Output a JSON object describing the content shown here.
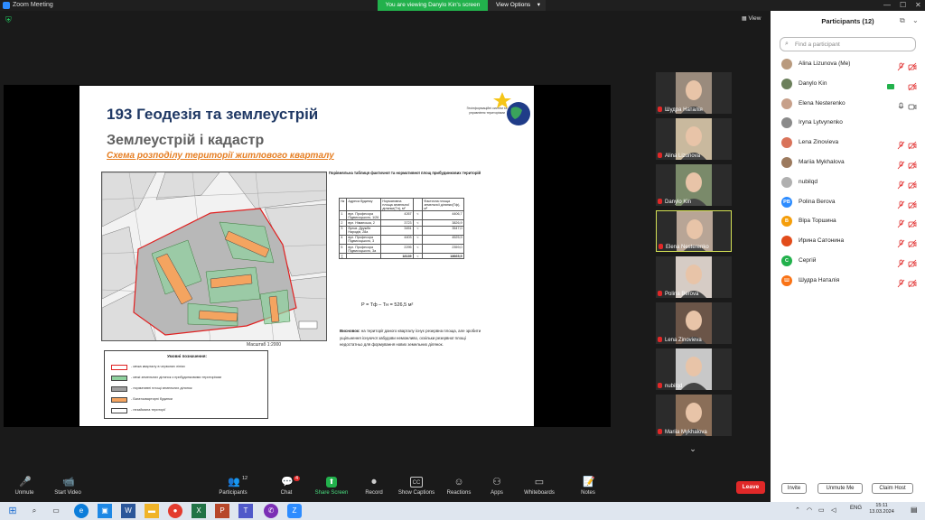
{
  "titlebar": {
    "title": "Zoom Meeting",
    "min": "—",
    "max": "☐",
    "close": "✕"
  },
  "banner": {
    "viewing": "You are viewing Danylo Kin's screen",
    "view_options": "View Options"
  },
  "view_button": "View",
  "slide": {
    "title": "193 Геодезія та землеустрій",
    "subtitle": "Землеустрій і кадастр",
    "section": "Схема розподілу території  житлового кварталу",
    "org_text": "Геоінформаційні систем та управління територіями",
    "map_scale": "Масштаб 1:2000",
    "legend_title": "Умовні позначення:",
    "legend_items": [
      {
        "label": "- межа кварталу в червоних лініях",
        "color": "#ffffff",
        "border": "#e02020"
      },
      {
        "label": "- межі земельних ділянок з прибудинковими територіями",
        "color": "#8fd19e",
        "border": "#444444"
      },
      {
        "label": "- нормативні площі земельних ділянок",
        "color": "#a0a0a0",
        "border": "#444444"
      },
      {
        "label": "- Багатоквартирні будинки",
        "color": "#f4a460",
        "border": "#444444"
      },
      {
        "label": "- незаймана території",
        "color": "#ffffff",
        "border": "#444444"
      }
    ],
    "table_title": "Порівняльна таблиця фактичної та нормативної  площ прибудинкових територій",
    "table_headers": [
      "№",
      "Адреса будинку",
      "Нормативна площа земельної ділянки(Tн), м²",
      "",
      "Фактична площа земельної ділянки(Tф), м²"
    ],
    "table_rows": [
      [
        "1",
        "вул. Професора Підвисоцького, 1/26",
        "4267",
        "<",
        "4406,7"
      ],
      [
        "2",
        "вул. Німанська, 2",
        "3723",
        "<",
        "3826,9"
      ],
      [
        "3",
        "бульв. Дружби Народів, 28а",
        "3451",
        "<",
        "3547,0"
      ],
      [
        "4",
        "вул. Професора Підвисоцького, 3",
        "4403",
        "<",
        "4525,9"
      ],
      [
        "5",
        "вул. Професора Підвисоцького, 3а",
        "2295",
        "<",
        "2359,0"
      ],
      [
        "∑",
        "",
        "18139",
        "<",
        "18665,5"
      ]
    ],
    "formula": "P = Tф – Tн = 526,5 м²",
    "conclusion_label": "Висновок:",
    "conclusion_text": "на території даного кварталу існує резервна площа, але зробити ущільнення існуючої забудови неможливо, оскільки резервної площі недостатньо для формування нових земельних ділянок."
  },
  "video_tiles": [
    {
      "name": "Шудра Наталія",
      "bg": "#9a8b7d",
      "active": false
    },
    {
      "name": "Alina Lizunova",
      "bg": "#c9b99e",
      "active": false
    },
    {
      "name": "Danylo Kin",
      "bg": "#7a8a6a",
      "active": false
    },
    {
      "name": "Elena Nesterenko",
      "bg": "#b8a596",
      "active": true
    },
    {
      "name": "Polina Berova",
      "bg": "#d6ccc5",
      "active": false
    },
    {
      "name": "Lena Zinovieva",
      "bg": "#6b5548",
      "active": false
    },
    {
      "name": "nubilqd",
      "bg": "#c8c8c8",
      "active": false
    },
    {
      "name": "Mariia Mykhalova",
      "bg": "#8a6e58",
      "active": false
    }
  ],
  "toolbar": [
    {
      "label": "Unmute",
      "icon": "🎤"
    },
    {
      "label": "Start Video",
      "icon": "📹"
    },
    {
      "label": "Participants",
      "icon": "👥",
      "badge": "12"
    },
    {
      "label": "Chat",
      "icon": "💬",
      "badge": "4"
    },
    {
      "label": "Share Screen",
      "icon": "⬆"
    },
    {
      "label": "Record",
      "icon": "⏺"
    },
    {
      "label": "Show Captions",
      "icon": "CC"
    },
    {
      "label": "Reactions",
      "icon": "☺"
    },
    {
      "label": "Apps",
      "icon": "⚇"
    },
    {
      "label": "Whiteboards",
      "icon": "▭"
    },
    {
      "label": "Notes",
      "icon": "📝"
    }
  ],
  "leave_label": "Leave",
  "panel": {
    "title": "Participants (12)",
    "search_placeholder": "Find a participant",
    "participants": [
      {
        "name": "Alina Lizunova (Me)",
        "avatar": "",
        "avatar_bg": "#b99a7e",
        "mic": "muted",
        "cam": "off"
      },
      {
        "name": "Danylo Kin",
        "avatar": "",
        "avatar_bg": "#6b7f5b",
        "mic": "sharing",
        "cam": "off"
      },
      {
        "name": "Elena Nesterenko",
        "avatar": "",
        "avatar_bg": "#c7a08a",
        "mic": "on",
        "cam": "on"
      },
      {
        "name": "Iryna Lytvynenko",
        "avatar": "",
        "avatar_bg": "#8a8a8a",
        "mic": "none",
        "cam": "none"
      },
      {
        "name": "Lena Zinovieva",
        "avatar": "",
        "avatar_bg": "#d9735a",
        "mic": "muted",
        "cam": "off"
      },
      {
        "name": "Mariia Mykhalova",
        "avatar": "",
        "avatar_bg": "#9c7a5e",
        "mic": "muted",
        "cam": "off"
      },
      {
        "name": "nubilqd",
        "avatar": "",
        "avatar_bg": "#b0b0b0",
        "mic": "muted",
        "cam": "off"
      },
      {
        "name": "Polina Berova",
        "avatar": "PB",
        "avatar_bg": "#2d8cff",
        "mic": "muted",
        "cam": "off"
      },
      {
        "name": "Віра Торшина",
        "avatar": "В",
        "avatar_bg": "#f59e0b",
        "mic": "muted",
        "cam": "off"
      },
      {
        "name": "Ирина Сатонина",
        "avatar": "",
        "avatar_bg": "#e24c1b",
        "mic": "muted",
        "cam": "off"
      },
      {
        "name": "Сергій",
        "avatar": "С",
        "avatar_bg": "#22b14c",
        "mic": "muted",
        "cam": "off"
      },
      {
        "name": "Шудра Наталія",
        "avatar": "Ш",
        "avatar_bg": "#f97316",
        "mic": "muted",
        "cam": "off"
      }
    ],
    "buttons": {
      "invite": "Invite",
      "unmute_me": "Unmute Me",
      "claim_host": "Claim Host"
    }
  },
  "taskbar": {
    "tray_lang": "ENG",
    "time": "15:11",
    "date": "13.03.2024"
  },
  "colors": {
    "accent": "#2d8cff",
    "banner": "#22b14c",
    "leave": "#e02828",
    "muted": "#e02828"
  }
}
